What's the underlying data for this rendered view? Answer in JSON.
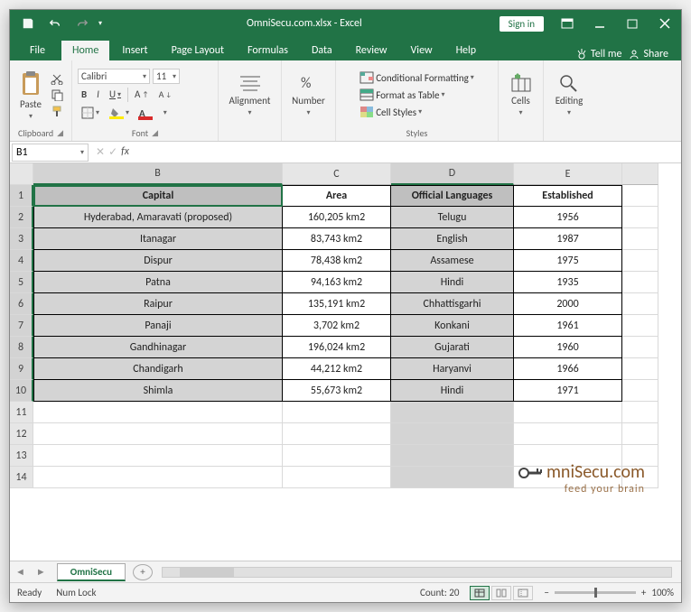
{
  "title": "OmniSecu.com.xlsx - Excel",
  "signin": "Sign in",
  "tabs": {
    "file": "File",
    "home": "Home",
    "insert": "Insert",
    "pagelayout": "Page Layout",
    "formulas": "Formulas",
    "data": "Data",
    "review": "Review",
    "view": "View",
    "help": "Help",
    "tellme": "Tell me",
    "share": "Share"
  },
  "ribbon": {
    "clipboard": {
      "label": "Clipboard",
      "paste": "Paste"
    },
    "font": {
      "label": "Font",
      "name": "Calibri",
      "size": "11"
    },
    "alignment": {
      "label": "Alignment"
    },
    "number": {
      "label": "Number"
    },
    "styles": {
      "label": "Styles",
      "cond": "Conditional Formatting",
      "table": "Format as Table",
      "cell": "Cell Styles"
    },
    "cells": {
      "label": "Cells"
    },
    "editing": {
      "label": "Editing"
    }
  },
  "namebox": "B1",
  "columns": [
    "B",
    "C",
    "D",
    "E"
  ],
  "headers": {
    "b": "Capital",
    "c": "Area",
    "d": "Official Languages",
    "e": "Established"
  },
  "rows": [
    {
      "b": "Hyderabad, Amaravati (proposed)",
      "c": "160,205 km2",
      "d": "Telugu",
      "e": "1956"
    },
    {
      "b": "Itanagar",
      "c": "83,743 km2",
      "d": "English",
      "e": "1987"
    },
    {
      "b": "Dispur",
      "c": "78,438 km2",
      "d": "Assamese",
      "e": "1975"
    },
    {
      "b": "Patna",
      "c": "94,163 km2",
      "d": "Hindi",
      "e": "1935"
    },
    {
      "b": "Raipur",
      "c": "135,191 km2",
      "d": "Chhattisgarhi",
      "e": "2000"
    },
    {
      "b": "Panaji",
      "c": "3,702 km2",
      "d": "Konkani",
      "e": "1961"
    },
    {
      "b": "Gandhinagar",
      "c": "196,024 km2",
      "d": "Gujarati",
      "e": "1960"
    },
    {
      "b": "Chandigarh",
      "c": "44,212 km2",
      "d": "Haryanvi",
      "e": "1966"
    },
    {
      "b": "Shimla",
      "c": "55,673 km2",
      "d": "Hindi",
      "e": "1971"
    }
  ],
  "sheet": "OmniSecu",
  "status": {
    "ready": "Ready",
    "numlock": "Num Lock",
    "count_label": "Count:",
    "count": "20",
    "zoom": "100%"
  },
  "watermark": {
    "main": "mniSecu.com",
    "sub": "feed your brain"
  }
}
